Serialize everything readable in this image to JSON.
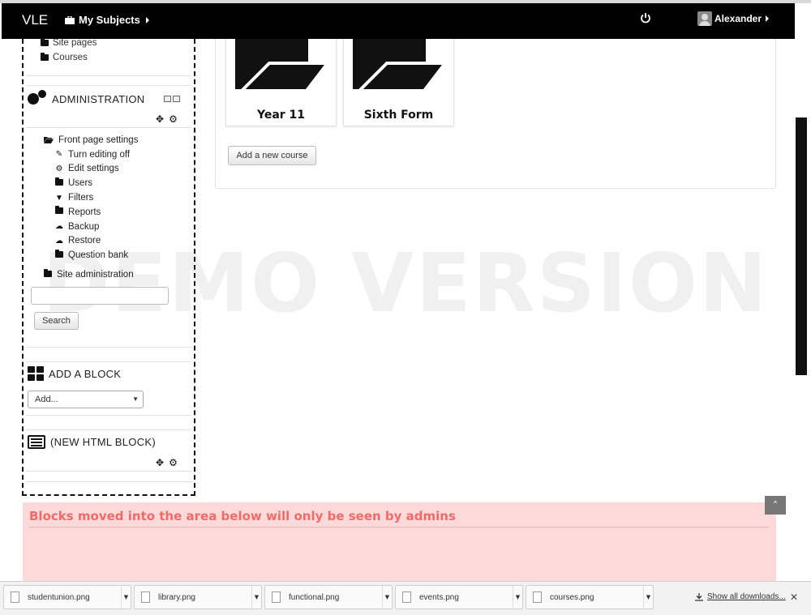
{
  "topbar": {
    "brand": "VLE",
    "subjects_label": "My Subjects",
    "user_name": "Alexander"
  },
  "navigation": {
    "items": [
      {
        "label": "Site pages"
      },
      {
        "label": "Courses"
      }
    ]
  },
  "administration": {
    "title": "ADMINISTRATION",
    "front_page_settings": "Front page settings",
    "children": [
      {
        "label": "Turn editing off",
        "icon": "pencil-icon"
      },
      {
        "label": "Edit settings",
        "icon": "gear-icon"
      },
      {
        "label": "Users",
        "icon": "folder-icon"
      },
      {
        "label": "Filters",
        "icon": "filter-icon"
      },
      {
        "label": "Reports",
        "icon": "folder-icon"
      },
      {
        "label": "Backup",
        "icon": "cloud-icon"
      },
      {
        "label": "Restore",
        "icon": "cloud-icon"
      },
      {
        "label": "Question bank",
        "icon": "folder-icon"
      }
    ],
    "site_administration": "Site administration",
    "search_value": "",
    "search_button": "Search"
  },
  "add_block": {
    "title": "ADD A BLOCK",
    "selected": "Add..."
  },
  "html_block": {
    "title": "(NEW HTML BLOCK)"
  },
  "courses": [
    {
      "label": "Year 11"
    },
    {
      "label": "Sixth Form"
    }
  ],
  "add_course_button": "Add a new course",
  "watermark": "DEMO VERSION",
  "admin_area_message": "Blocks moved into the area below will only be seen by admins",
  "downloads": {
    "files": [
      {
        "name": "studentunion.png"
      },
      {
        "name": "library.png"
      },
      {
        "name": "functional.png"
      },
      {
        "name": "events.png"
      },
      {
        "name": "courses.png"
      }
    ],
    "show_all": "Show all downloads..."
  }
}
